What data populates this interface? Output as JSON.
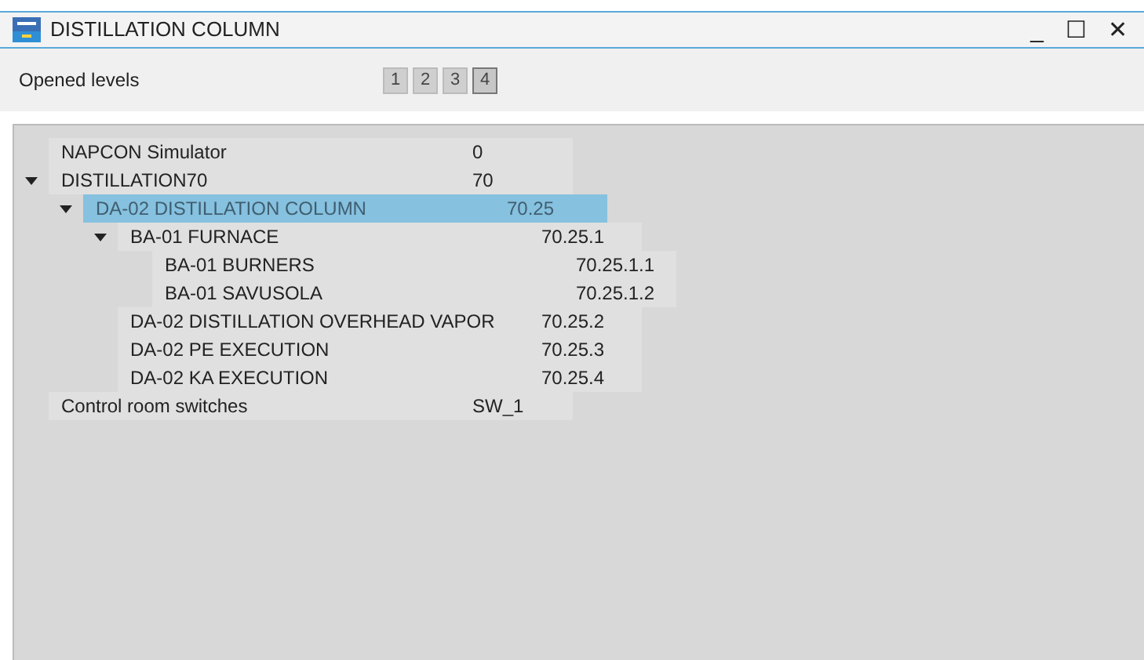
{
  "window": {
    "title": "DISTILLATION COLUMN",
    "controls": [
      "_",
      "☐",
      "✕"
    ]
  },
  "levels": {
    "label": "Opened levels",
    "buttons": [
      {
        "label": "1",
        "selected": false
      },
      {
        "label": "2",
        "selected": false
      },
      {
        "label": "3",
        "selected": false
      },
      {
        "label": "4",
        "selected": true
      }
    ]
  },
  "tree": [
    {
      "name": "NAPCON Simulator",
      "code": "0",
      "selected": false
    },
    {
      "name": "DISTILLATION70",
      "code": "70",
      "selected": false,
      "expanded": true,
      "children": [
        {
          "name": "DA-02 DISTILLATION COLUMN",
          "code": "70.25",
          "selected": true,
          "expanded": true,
          "children": [
            {
              "name": "BA-01 FURNACE",
              "code": "70.25.1",
              "selected": false,
              "expanded": true,
              "children": [
                {
                  "name": "BA-01 BURNERS",
                  "code": "70.25.1.1",
                  "selected": false
                },
                {
                  "name": "BA-01 SAVUSOLA",
                  "code": "70.25.1.2",
                  "selected": false
                }
              ]
            },
            {
              "name": "DA-02 DISTILLATION OVERHEAD VAPOR",
              "code": "70.25.2",
              "selected": false
            },
            {
              "name": "DA-02 PE EXECUTION",
              "code": "70.25.3",
              "selected": false
            },
            {
              "name": "DA-02 KA EXECUTION",
              "code": "70.25.4",
              "selected": false
            }
          ]
        }
      ]
    },
    {
      "name": "Control room switches",
      "code": "SW_1",
      "selected": false
    }
  ]
}
